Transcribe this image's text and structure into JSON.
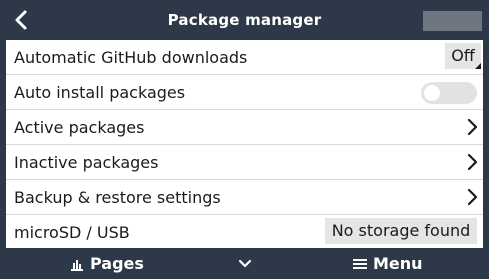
{
  "header": {
    "title": "Package manager",
    "back_icon": "chevron-left-icon"
  },
  "rows": [
    {
      "label": "Automatic GitHub downloads",
      "value": "Off"
    },
    {
      "label": "Auto install packages",
      "toggle_on": false
    },
    {
      "label": "Active packages",
      "icon": "chevron-right-icon"
    },
    {
      "label": "Inactive packages",
      "icon": "chevron-right-icon"
    },
    {
      "label": "Backup & restore settings",
      "icon": "chevron-right-icon"
    },
    {
      "label": "microSD / USB",
      "value": "No storage found"
    }
  ],
  "footer": {
    "pages_label": "Pages",
    "pages_icon": "bar-chart-icon",
    "center_icon": "chevron-down-icon",
    "menu_label": "Menu",
    "menu_icon": "hamburger-menu-icon"
  },
  "colors": {
    "header_bg": "#2d3848",
    "list_bg": "#ffffff",
    "value_bg": "#e5e5e5",
    "text": "#1b1b1b"
  }
}
